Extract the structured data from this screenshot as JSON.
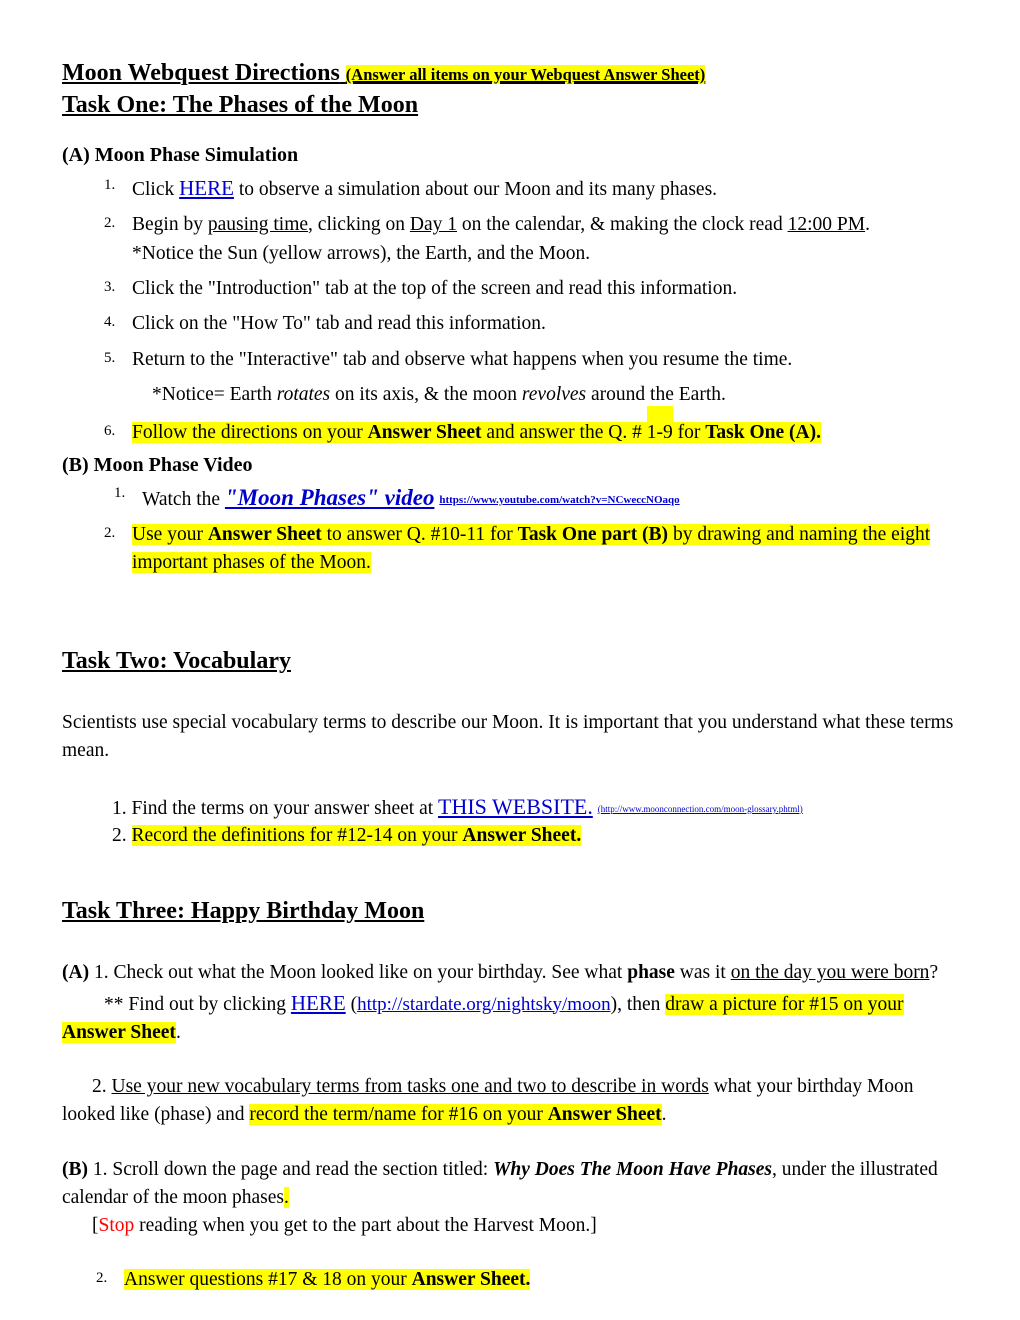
{
  "document": {
    "title_main": "Moon Webquest Directions",
    "title_sub": "(Answer all items on your Webquest Answer Sheet)"
  },
  "task_one": {
    "heading": "Task One: The Phases of the Moon",
    "part_a": {
      "heading": "(A) Moon Phase Simulation",
      "steps": [
        {
          "num": "1.",
          "pre": "Click ",
          "link": "HERE",
          "post": " to observe a simulation about our Moon and its many phases."
        },
        {
          "num": "2.",
          "seg1": "Begin by ",
          "u1": "pausing time",
          "seg2": ", clicking on ",
          "u2": "Day 1",
          "seg3": " on the calendar, &  making the clock read ",
          "u3": "12:00 PM",
          "seg4": ".",
          "line2": "*Notice the Sun (yellow arrows), the Earth, and the Moon."
        },
        {
          "num": "3.",
          "text": "Click the \"Introduction\" tab at the top of the screen and read this information."
        },
        {
          "num": "4.",
          "text": "Click on the \"How To\" tab and read this information."
        },
        {
          "num": "5.",
          "text": "Return to the \"Interactive\" tab and observe what happens when you resume the   time."
        }
      ],
      "notice_line": {
        "pre": "*Notice= Earth ",
        "i1": "rotates",
        "mid": " on its axis, & the moon ",
        "i2": "revolves",
        "post": " around the Earth."
      },
      "step6": {
        "num": "6.",
        "seg1": "Follow the directions on your ",
        "b1": "Answer Sheet",
        "seg2": " and answer the Q. # ",
        "hl_num": "1-9",
        "seg3": "  for ",
        "b2": "Task One (A)."
      }
    },
    "part_b": {
      "heading": "(B) Moon Phase Video",
      "step1": {
        "num": "1.",
        "pre": "Watch the ",
        "link": "\"Moon Phases\" video",
        "url": "https://www.youtube.com/watch?v=NCweccNOaqo"
      },
      "step2": {
        "num": "2.",
        "seg1": "Use your ",
        "b1": "Answer Sheet",
        "seg2": " to answer Q. #10-11 for ",
        "b2": "Task One part (B)",
        "seg3": " by drawing and naming the eight important phases of the Moon."
      }
    }
  },
  "task_two": {
    "heading": "Task Two: Vocabulary",
    "intro": "Scientists use special vocabulary terms to describe our Moon. It is important that you understand what these terms mean.",
    "item1": {
      "num": "1.",
      "pre": "Find the terms on your answer sheet  at  ",
      "link": "THIS WEBSITE.",
      "url": "(http://www.moonconnection.com/moon-glossary.phtml)"
    },
    "item2": {
      "num": "2.",
      "seg1": "Record the definitions for #12-14 on your ",
      "b1": "Answer Sheet."
    }
  },
  "task_three": {
    "heading": "Task Three: Happy Birthday Moon",
    "part_a": {
      "label": "(A)",
      "item1_seg1": " 1. Check out what the Moon looked like on your birthday. See what  ",
      "item1_bold": "phase",
      "item1_seg2": " was it ",
      "item1_underline": "on the day you were born",
      "item1_seg3": "?",
      "item1_line2_pre": "** Find out by clicking ",
      "item1_link": "HERE",
      "item1_url_open": " (",
      "item1_url": "http://stardate.org/nightsky/moon",
      "item1_url_close": "), then ",
      "item1_hl1": "draw a picture for #15 on your ",
      "item1_hl_bold": "Answer Sheet",
      "item1_end": ".",
      "item2_num": "2.",
      "item2_underline": "Use your new vocabulary terms from tasks one and two to describe in words",
      "item2_seg1": " what your birthday Moon looked like (phase) and ",
      "item2_hl1": "record the term/name for #16  on your ",
      "item2_hl_bold": "Answer Sheet",
      "item2_end": "."
    },
    "part_b": {
      "label": "(B)",
      "item1_seg1": " 1. Scroll down the page and read the section titled: ",
      "item1_bolditalic": "Why Does The Moon Have Phases",
      "item1_seg2": ", under the illustrated calendar of the moon phases",
      "item1_hl_period": ".",
      "stop_open": "[",
      "stop_word": "Stop",
      "stop_rest": " reading when you get to the part about the Harvest Moon.]",
      "item2_num": "2.",
      "item2_seg1": "Answer questions #17 & 18 on your ",
      "item2_bold": "Answer Sheet."
    }
  },
  "colors": {
    "highlight": "#ffff00",
    "link": "#0000cc",
    "stop_red": "#ff0000",
    "text": "#000000"
  }
}
